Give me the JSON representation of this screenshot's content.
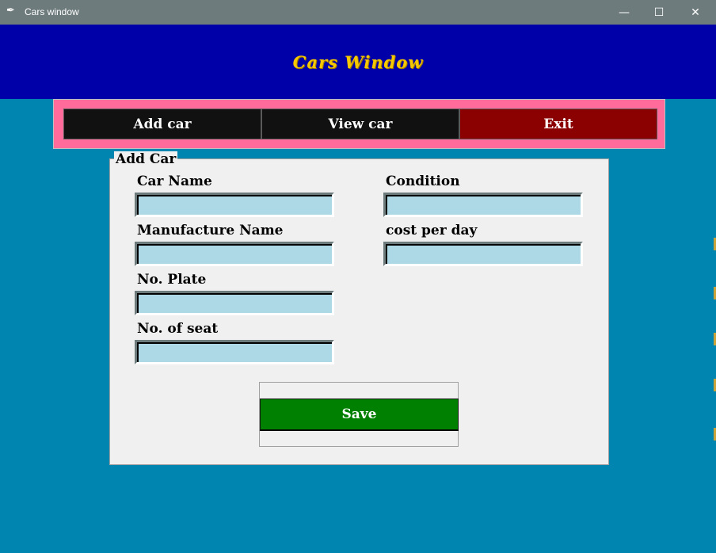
{
  "window": {
    "title": "Cars window",
    "icon": "feather-icon",
    "minimize": "—",
    "maximize": "☐",
    "close": "✕"
  },
  "header": {
    "title": "Cars Window"
  },
  "nav": {
    "add_car": "Add car",
    "view_car": "View car",
    "exit": "Exit"
  },
  "form": {
    "legend": "Add Car",
    "car_name_label": "Car Name",
    "condition_label": "Condition",
    "manufacture_name_label": "Manufacture Name",
    "cost_per_day_label": "cost per day",
    "no_plate_label": "No. Plate",
    "no_of_seat_label": "No. of seat",
    "save_label": "Save"
  },
  "colors": {
    "background": "#0085b0",
    "header": "#0000a8",
    "header_title": "#f5c800",
    "navbar": "#ff6b9a",
    "nav_button": "#111111",
    "exit_button": "#8b0000",
    "entry": "#add8e6",
    "save_button": "#008000"
  }
}
